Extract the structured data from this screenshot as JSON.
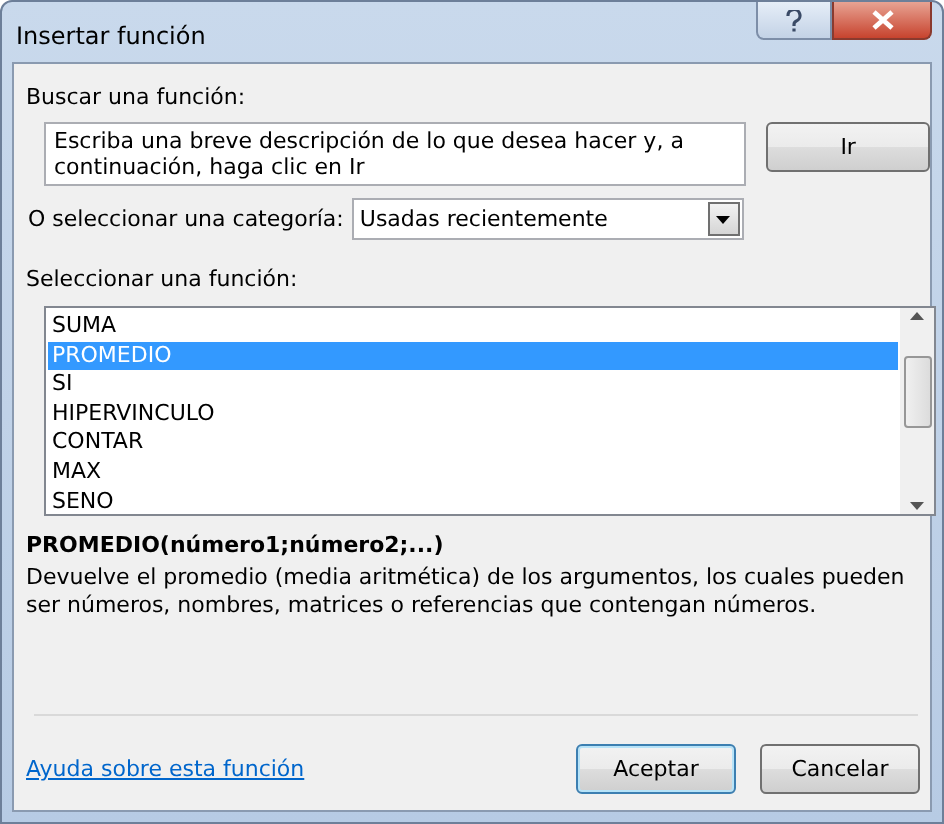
{
  "window": {
    "title": "Insertar función"
  },
  "search": {
    "label": "Buscar una función:",
    "value": "Escriba una breve descripción de lo que desea hacer y, a continuación, haga clic en Ir",
    "button": "Ir"
  },
  "category": {
    "label": "O seleccionar una categoría:",
    "value": "Usadas recientemente"
  },
  "functions": {
    "label": "Seleccionar una función:",
    "items": [
      {
        "name": "SUMA",
        "selected": false
      },
      {
        "name": "PROMEDIO",
        "selected": true
      },
      {
        "name": "SI",
        "selected": false
      },
      {
        "name": "HIPERVINCULO",
        "selected": false
      },
      {
        "name": "CONTAR",
        "selected": false
      },
      {
        "name": "MAX",
        "selected": false
      },
      {
        "name": "SENO",
        "selected": false
      }
    ]
  },
  "signature": "PROMEDIO(número1;número2;...)",
  "description": "Devuelve el promedio (media aritmética) de los argumentos, los cuales pueden ser números, nombres, matrices o referencias que contengan números.",
  "help_link": "Ayuda sobre esta función",
  "buttons": [
    {
      "label": "Aceptar",
      "default": true
    },
    {
      "label": "Cancelar",
      "default": false
    }
  ]
}
